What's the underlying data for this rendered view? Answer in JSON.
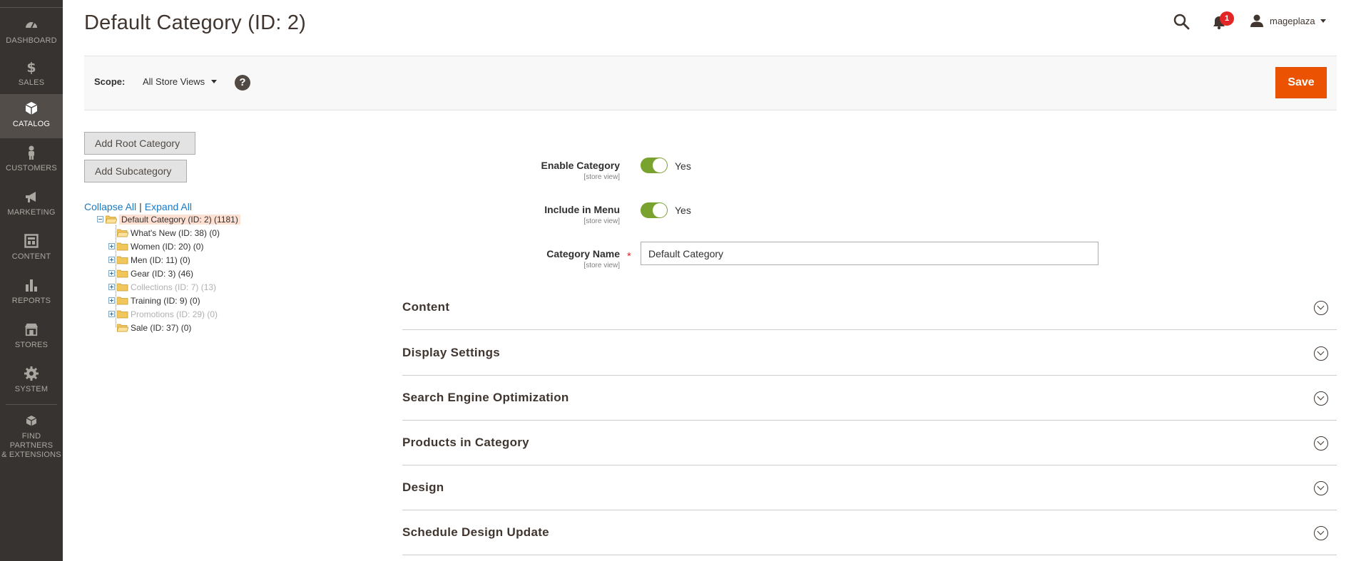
{
  "sidebar": {
    "items": [
      {
        "label": "DASHBOARD",
        "icon": "dashboard-icon"
      },
      {
        "label": "SALES",
        "icon": "dollar-icon"
      },
      {
        "label": "CATALOG",
        "icon": "box-icon",
        "active": true
      },
      {
        "label": "CUSTOMERS",
        "icon": "person-icon"
      },
      {
        "label": "MARKETING",
        "icon": "megaphone-icon"
      },
      {
        "label": "CONTENT",
        "icon": "layout-icon"
      },
      {
        "label": "REPORTS",
        "icon": "bar-chart-icon"
      },
      {
        "label": "STORES",
        "icon": "store-icon"
      },
      {
        "label": "SYSTEM",
        "icon": "gear-icon"
      }
    ],
    "partners": {
      "line1": "FIND PARTNERS",
      "line2": "& EXTENSIONS",
      "icon": "cubes-icon"
    }
  },
  "header": {
    "title": "Default Category (ID: 2)",
    "notifications_count": "1",
    "username": "mageplaza"
  },
  "scope": {
    "label": "Scope:",
    "value": "All Store Views",
    "help": "?"
  },
  "actions": {
    "save": "Save",
    "add_root": "Add Root Category",
    "add_sub": "Add Subcategory"
  },
  "tree": {
    "collapse_all": "Collapse All",
    "separator": "|",
    "expand_all": "Expand All",
    "root": "Default Category (ID: 2) (1181)",
    "children": [
      {
        "label": "What's New (ID: 38) (0)",
        "expandable": false,
        "dim": false
      },
      {
        "label": "Women (ID: 20) (0)",
        "expandable": true,
        "dim": false
      },
      {
        "label": "Men (ID: 11) (0)",
        "expandable": true,
        "dim": false
      },
      {
        "label": "Gear (ID: 3) (46)",
        "expandable": true,
        "dim": false
      },
      {
        "label": "Collections (ID: 7) (13)",
        "expandable": true,
        "dim": true
      },
      {
        "label": "Training (ID: 9) (0)",
        "expandable": true,
        "dim": false
      },
      {
        "label": "Promotions (ID: 29) (0)",
        "expandable": true,
        "dim": true
      },
      {
        "label": "Sale (ID: 37) (0)",
        "expandable": false,
        "dim": false
      }
    ]
  },
  "form": {
    "enable_category": {
      "label": "Enable Category",
      "scope": "[store view]",
      "value": "Yes"
    },
    "include_in_menu": {
      "label": "Include in Menu",
      "scope": "[store view]",
      "value": "Yes"
    },
    "category_name": {
      "label": "Category Name",
      "scope": "[store view]",
      "required": "*",
      "value": "Default Category"
    }
  },
  "sections": [
    "Content",
    "Display Settings",
    "Search Engine Optimization",
    "Products in Category",
    "Design",
    "Schedule Design Update"
  ],
  "colors": {
    "sidebar_bg": "#373330",
    "sidebar_active": "#524d49",
    "save_orange": "#eb5202",
    "toggle_green": "#79a22e",
    "link_blue": "#1979c3",
    "badge_red": "#e22626"
  }
}
